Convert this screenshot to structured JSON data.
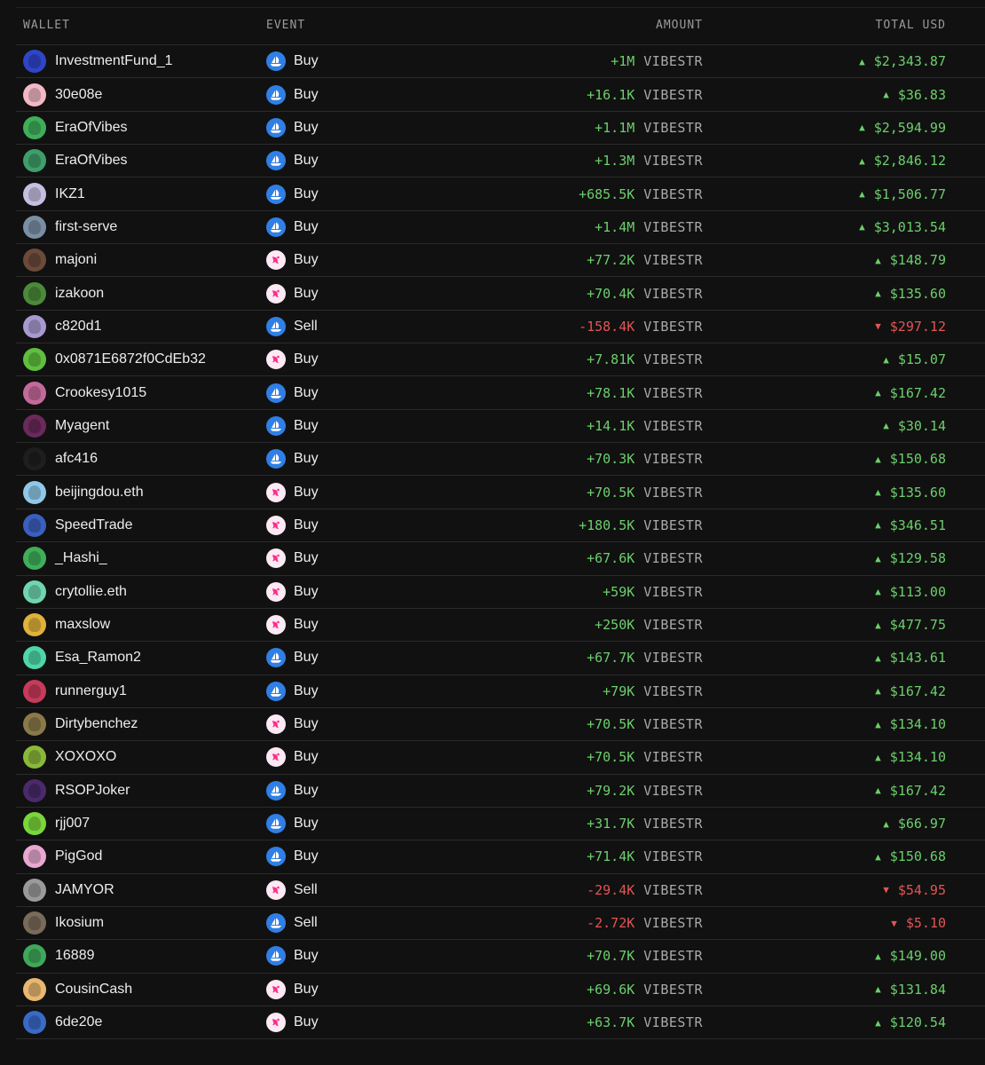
{
  "columns": {
    "wallet": "WALLET",
    "event": "EVENT",
    "amount": "AMOUNT",
    "total": "TOTAL USD"
  },
  "rows": [
    {
      "wallet": "InvestmentFund_1",
      "avatar_color": "#2f45c9",
      "platform": "opensea",
      "event": "Buy",
      "amount": "+1M",
      "token": "VIBESTR",
      "direction": "up",
      "total": "$2,343.87"
    },
    {
      "wallet": "30e08e",
      "avatar_color": "#f2b8c6",
      "platform": "opensea",
      "event": "Buy",
      "amount": "+16.1K",
      "token": "VIBESTR",
      "direction": "up",
      "total": "$36.83"
    },
    {
      "wallet": "EraOfVibes",
      "avatar_color": "#3fae5a",
      "platform": "opensea",
      "event": "Buy",
      "amount": "+1.1M",
      "token": "VIBESTR",
      "direction": "up",
      "total": "$2,594.99"
    },
    {
      "wallet": "EraOfVibes",
      "avatar_color": "#3f9e6a",
      "platform": "opensea",
      "event": "Buy",
      "amount": "+1.3M",
      "token": "VIBESTR",
      "direction": "up",
      "total": "$2,846.12"
    },
    {
      "wallet": "IKZ1",
      "avatar_color": "#c7bfe0",
      "platform": "opensea",
      "event": "Buy",
      "amount": "+685.5K",
      "token": "VIBESTR",
      "direction": "up",
      "total": "$1,506.77"
    },
    {
      "wallet": "first-serve",
      "avatar_color": "#7a8fa3",
      "platform": "opensea",
      "event": "Buy",
      "amount": "+1.4M",
      "token": "VIBESTR",
      "direction": "up",
      "total": "$3,013.54"
    },
    {
      "wallet": "majoni",
      "avatar_color": "#6b4a3a",
      "platform": "uniswap",
      "event": "Buy",
      "amount": "+77.2K",
      "token": "VIBESTR",
      "direction": "up",
      "total": "$148.79"
    },
    {
      "wallet": "izakoon",
      "avatar_color": "#4a8a3a",
      "platform": "uniswap",
      "event": "Buy",
      "amount": "+70.4K",
      "token": "VIBESTR",
      "direction": "up",
      "total": "$135.60"
    },
    {
      "wallet": "c820d1",
      "avatar_color": "#a89ad0",
      "platform": "opensea",
      "event": "Sell",
      "amount": "-158.4K",
      "token": "VIBESTR",
      "direction": "down",
      "total": "$297.12"
    },
    {
      "wallet": "0x0871E6872f0CdEb32",
      "avatar_color": "#5fbf3f",
      "platform": "uniswap",
      "event": "Buy",
      "amount": "+7.81K",
      "token": "VIBESTR",
      "direction": "up",
      "total": "$15.07"
    },
    {
      "wallet": "Crookesy1015",
      "avatar_color": "#c46a9a",
      "platform": "opensea",
      "event": "Buy",
      "amount": "+78.1K",
      "token": "VIBESTR",
      "direction": "up",
      "total": "$167.42"
    },
    {
      "wallet": "Myagent",
      "avatar_color": "#6a2a5a",
      "platform": "opensea",
      "event": "Buy",
      "amount": "+14.1K",
      "token": "VIBESTR",
      "direction": "up",
      "total": "$30.14"
    },
    {
      "wallet": "afc416",
      "avatar_color": "#1e1e1e",
      "platform": "opensea",
      "event": "Buy",
      "amount": "+70.3K",
      "token": "VIBESTR",
      "direction": "up",
      "total": "$150.68"
    },
    {
      "wallet": "beijingdou.eth",
      "avatar_color": "#8fc8e8",
      "platform": "uniswap",
      "event": "Buy",
      "amount": "+70.5K",
      "token": "VIBESTR",
      "direction": "up",
      "total": "$135.60"
    },
    {
      "wallet": "SpeedTrade",
      "avatar_color": "#3a5fbf",
      "platform": "uniswap",
      "event": "Buy",
      "amount": "+180.5K",
      "token": "VIBESTR",
      "direction": "up",
      "total": "$346.51"
    },
    {
      "wallet": "_Hashi_",
      "avatar_color": "#3fae5a",
      "platform": "uniswap",
      "event": "Buy",
      "amount": "+67.6K",
      "token": "VIBESTR",
      "direction": "up",
      "total": "$129.58"
    },
    {
      "wallet": "crytollie.eth",
      "avatar_color": "#6fd6b0",
      "platform": "uniswap",
      "event": "Buy",
      "amount": "+59K",
      "token": "VIBESTR",
      "direction": "up",
      "total": "$113.00"
    },
    {
      "wallet": "maxslow",
      "avatar_color": "#e0b23a",
      "platform": "uniswap",
      "event": "Buy",
      "amount": "+250K",
      "token": "VIBESTR",
      "direction": "up",
      "total": "$477.75"
    },
    {
      "wallet": "Esa_Ramon2",
      "avatar_color": "#4fd6a8",
      "platform": "opensea",
      "event": "Buy",
      "amount": "+67.7K",
      "token": "VIBESTR",
      "direction": "up",
      "total": "$143.61"
    },
    {
      "wallet": "runnerguy1",
      "avatar_color": "#c83a5a",
      "platform": "opensea",
      "event": "Buy",
      "amount": "+79K",
      "token": "VIBESTR",
      "direction": "up",
      "total": "$167.42"
    },
    {
      "wallet": "Dirtybenchez",
      "avatar_color": "#8a7a4a",
      "platform": "uniswap",
      "event": "Buy",
      "amount": "+70.5K",
      "token": "VIBESTR",
      "direction": "up",
      "total": "$134.10"
    },
    {
      "wallet": "XOXOXO",
      "avatar_color": "#8ab83a",
      "platform": "uniswap",
      "event": "Buy",
      "amount": "+70.5K",
      "token": "VIBESTR",
      "direction": "up",
      "total": "$134.10"
    },
    {
      "wallet": "RSOPJoker",
      "avatar_color": "#4a2a6a",
      "platform": "opensea",
      "event": "Buy",
      "amount": "+79.2K",
      "token": "VIBESTR",
      "direction": "up",
      "total": "$167.42"
    },
    {
      "wallet": "rjj007",
      "avatar_color": "#7ad63a",
      "platform": "opensea",
      "event": "Buy",
      "amount": "+31.7K",
      "token": "VIBESTR",
      "direction": "up",
      "total": "$66.97"
    },
    {
      "wallet": "PigGod",
      "avatar_color": "#e8a8d0",
      "platform": "opensea",
      "event": "Buy",
      "amount": "+71.4K",
      "token": "VIBESTR",
      "direction": "up",
      "total": "$150.68"
    },
    {
      "wallet": "JAMYOR",
      "avatar_color": "#9a9a9a",
      "platform": "uniswap",
      "event": "Sell",
      "amount": "-29.4K",
      "token": "VIBESTR",
      "direction": "down",
      "total": "$54.95"
    },
    {
      "wallet": "Ikosium",
      "avatar_color": "#7a6a5a",
      "platform": "opensea",
      "event": "Sell",
      "amount": "-2.72K",
      "token": "VIBESTR",
      "direction": "down",
      "total": "$5.10"
    },
    {
      "wallet": "16889",
      "avatar_color": "#3fa85a",
      "platform": "opensea",
      "event": "Buy",
      "amount": "+70.7K",
      "token": "VIBESTR",
      "direction": "up",
      "total": "$149.00"
    },
    {
      "wallet": "CousinCash",
      "avatar_color": "#e8b870",
      "platform": "uniswap",
      "event": "Buy",
      "amount": "+69.6K",
      "token": "VIBESTR",
      "direction": "up",
      "total": "$131.84"
    },
    {
      "wallet": "6de20e",
      "avatar_color": "#3a6ac8",
      "platform": "uniswap",
      "event": "Buy",
      "amount": "+63.7K",
      "token": "VIBESTR",
      "direction": "up",
      "total": "$120.54"
    }
  ]
}
